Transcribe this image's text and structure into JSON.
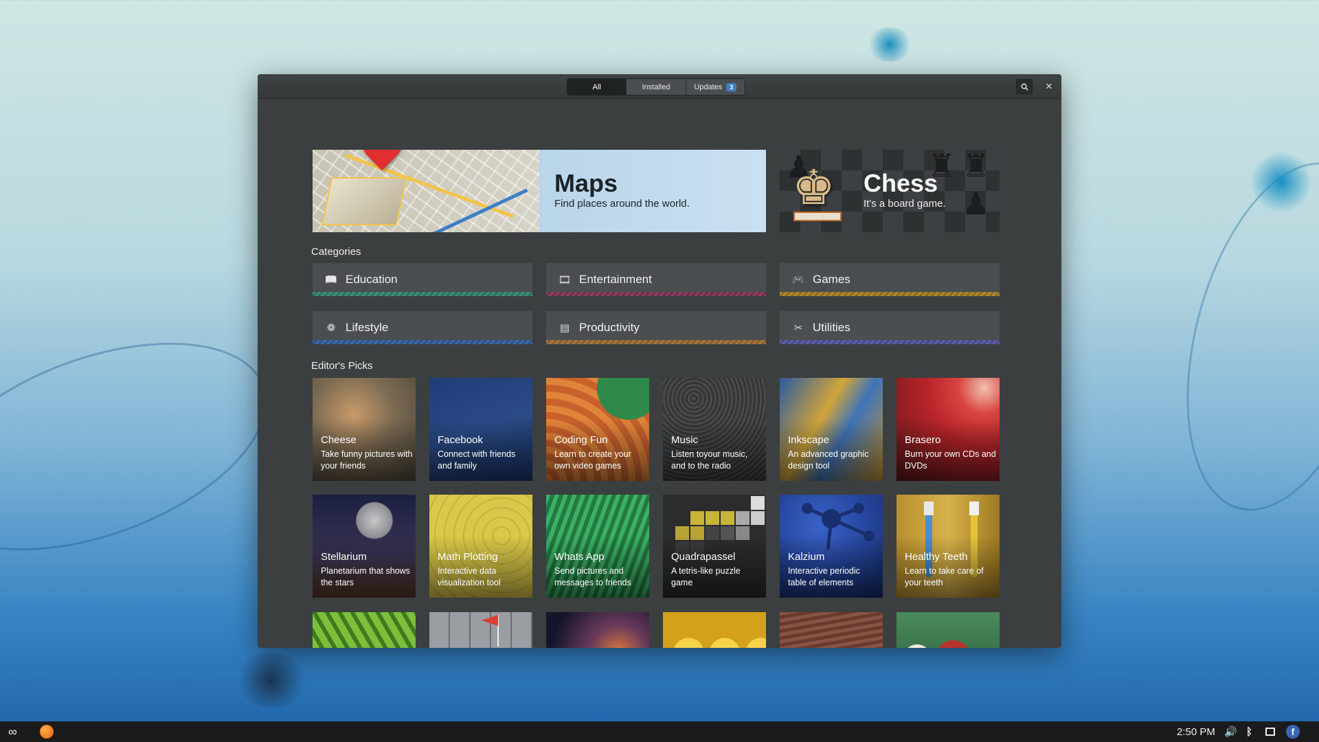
{
  "window": {
    "tabs": [
      {
        "label": "All",
        "active": true
      },
      {
        "label": "Installed",
        "active": false
      },
      {
        "label": "Updates",
        "active": false,
        "badge": "3"
      }
    ],
    "search_icon": "search-icon",
    "close_icon": "close-icon"
  },
  "banners": {
    "maps": {
      "title": "Maps",
      "subtitle": "Find places around the world."
    },
    "chess": {
      "title": "Chess",
      "subtitle": "It's a board game."
    }
  },
  "categories": {
    "heading": "Categories",
    "items": [
      {
        "label": "Education",
        "icon": "book-icon",
        "color": "#3f8f7e"
      },
      {
        "label": "Entertainment",
        "icon": "film-icon",
        "color": "#8a3f62"
      },
      {
        "label": "Games",
        "icon": "gamepad-icon",
        "color": "#b08a2e"
      },
      {
        "label": "Lifestyle",
        "icon": "leaf-icon",
        "color": "#3f6aa6"
      },
      {
        "label": "Productivity",
        "icon": "document-icon",
        "color": "#a8773e"
      },
      {
        "label": "Utilities",
        "icon": "tools-icon",
        "color": "#5f5ea6"
      }
    ]
  },
  "editors_picks": {
    "heading": "Editor's Picks",
    "row1": [
      {
        "name": "Cheese",
        "desc": "Take funny pictures with your friends",
        "bg": "#7a6a52"
      },
      {
        "name": "Facebook",
        "desc": "Connect with friends and family",
        "bg": "#2b4b86"
      },
      {
        "name": "Coding Fun",
        "desc": "Learn to create your own video games",
        "bg": "#d6703a"
      },
      {
        "name": "Music",
        "desc": "Listen toyour music, and to the radio",
        "bg": "#3f3f41"
      },
      {
        "name": "Inkscape",
        "desc": "An advanced graphic design tool",
        "bg": "#4a74a8"
      },
      {
        "name": "Brasero",
        "desc": "Burn your own CDs and DVDs",
        "bg": "#b8242a"
      }
    ],
    "row2": [
      {
        "name": "Stellarium",
        "desc": "Planetarium that shows the stars",
        "bg": "#2a2d4a"
      },
      {
        "name": "Math Plotting",
        "desc": "Interactive data visualization tool",
        "bg": "#d9c84a"
      },
      {
        "name": "Whats App",
        "desc": "Send pictures and messages to friends",
        "bg": "#2f9a56"
      },
      {
        "name": "Quadrapassel",
        "desc": "A tetris-like puzzle game",
        "bg": "#2c2c2e"
      },
      {
        "name": "Kalzium",
        "desc": "Interactive periodic table of elements",
        "bg": "#2748a0"
      },
      {
        "name": "Healthy Teeth",
        "desc": "Learn to take care of your teeth",
        "bg": "#c9a23a"
      }
    ],
    "row3": [
      {
        "bg": "#5e9a2e"
      },
      {
        "bg": "#8b8f92"
      },
      {
        "bg": "#23243a"
      },
      {
        "bg": "#e2b21e"
      },
      {
        "bg": "#7a4a3a"
      },
      {
        "bg": "#2f5a3a"
      }
    ]
  },
  "taskbar": {
    "clock": "2:50 PM",
    "icons": [
      "logo-icon",
      "orange-ball-icon",
      "volume-icon",
      "bluetooth-icon",
      "window-icon",
      "facebook-icon"
    ]
  }
}
